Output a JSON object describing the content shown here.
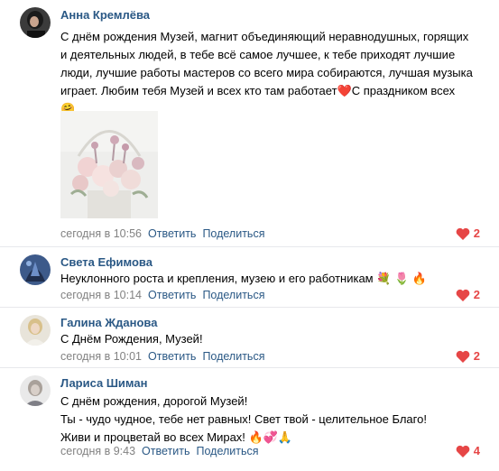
{
  "comments": [
    {
      "author": "Анна Кремлёва",
      "lines": [
        "С днём рождения Музей, магнит объединяющий неравнодушных, горящих",
        "и деятельных людей, в тебе всё самое лучшее, к тебе приходят лучшие",
        "люди, лучшие работы мастеров со всего мира собираются, лучшая музыка",
        "играет. Любим тебя Музей и всех кто там работает❤️С праздником всех",
        "🤗"
      ],
      "time": "сегодня в 10:56",
      "reply": "Ответить",
      "share": "Поделиться",
      "likes": "2"
    },
    {
      "author": "Света Ефимова",
      "lines": [
        "Неуклонного роста и крепления, музею и его работникам 💐 🌷 🔥"
      ],
      "time": "сегодня в 10:14",
      "reply": "Ответить",
      "share": "Поделиться",
      "likes": "2"
    },
    {
      "author": "Галина Жданова",
      "lines": [
        "С Днём Рождения, Музей!"
      ],
      "time": "сегодня в 10:01",
      "reply": "Ответить",
      "share": "Поделиться",
      "likes": "2"
    },
    {
      "author": "Лариса Шиман",
      "lines": [
        "С днём рождения, дорогой Музей!",
        "Ты - чудо чудное, тебе нет равных! Свет твой - целительное Благо!",
        "Живи и процветай во всех Мирах! 🔥💞🙏"
      ],
      "time": "сегодня в 9:43",
      "reply": "Ответить",
      "share": "Поделиться",
      "likes": "4"
    }
  ],
  "icons": {
    "like": "heart-icon"
  },
  "colors": {
    "link": "#2a5885",
    "meta": "#828282",
    "like": "#e64646"
  }
}
